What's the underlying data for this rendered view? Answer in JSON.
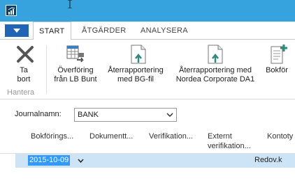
{
  "tabs": [
    "START",
    "ÅTGÄRDER",
    "ANALYSERA"
  ],
  "ribbon": {
    "buttons": [
      {
        "label": "Ta\nbort",
        "icon": "delete-x-icon"
      },
      {
        "label": "Överföring\nfrån LB Bunt",
        "icon": "transfer-table-icon"
      },
      {
        "label": "Återrapportering\nmed BG-fil",
        "icon": "document-arrow-icon"
      },
      {
        "label": "Återrapportering med\nNordea Corporate DA1",
        "icon": "document-arrow-icon"
      },
      {
        "label": "Bokför",
        "icon": "post-document-icon"
      }
    ],
    "group_label": "Hantera"
  },
  "journal": {
    "label": "Journalnamn:",
    "value": "BANK"
  },
  "columns": [
    "Bokförings...",
    "Dokumentt...",
    "Verifikation...",
    "Externt\nverifikation...",
    "Kontoty"
  ],
  "row": {
    "date": "2015-10-09",
    "account_type": "Redov.k"
  },
  "colors": {
    "titlebar": "#37a3de",
    "menu_button": "#1f64b7",
    "selection": "#3399ff",
    "row_highlight": "#cde4f7"
  }
}
